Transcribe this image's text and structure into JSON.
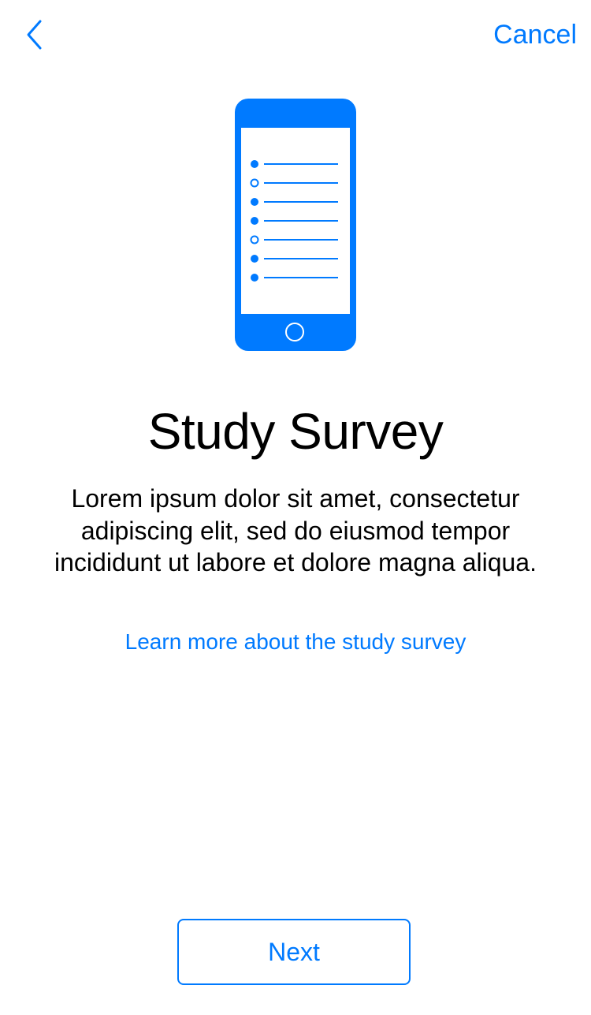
{
  "nav": {
    "back_icon": "chevron-left-icon",
    "cancel_label": "Cancel"
  },
  "hero": {
    "icon": "phone-survey-icon",
    "accent_color": "#007aff",
    "checklist": [
      "filled",
      "open",
      "filled",
      "filled",
      "open",
      "filled",
      "filled"
    ]
  },
  "content": {
    "title": "Study Survey",
    "body": "Lorem ipsum dolor sit amet, consectetur adipiscing elit, sed do eiusmod tempor incididunt ut labore et dolore magna aliqua.",
    "learn_more": "Learn more about the study survey"
  },
  "footer": {
    "next_label": "Next"
  }
}
